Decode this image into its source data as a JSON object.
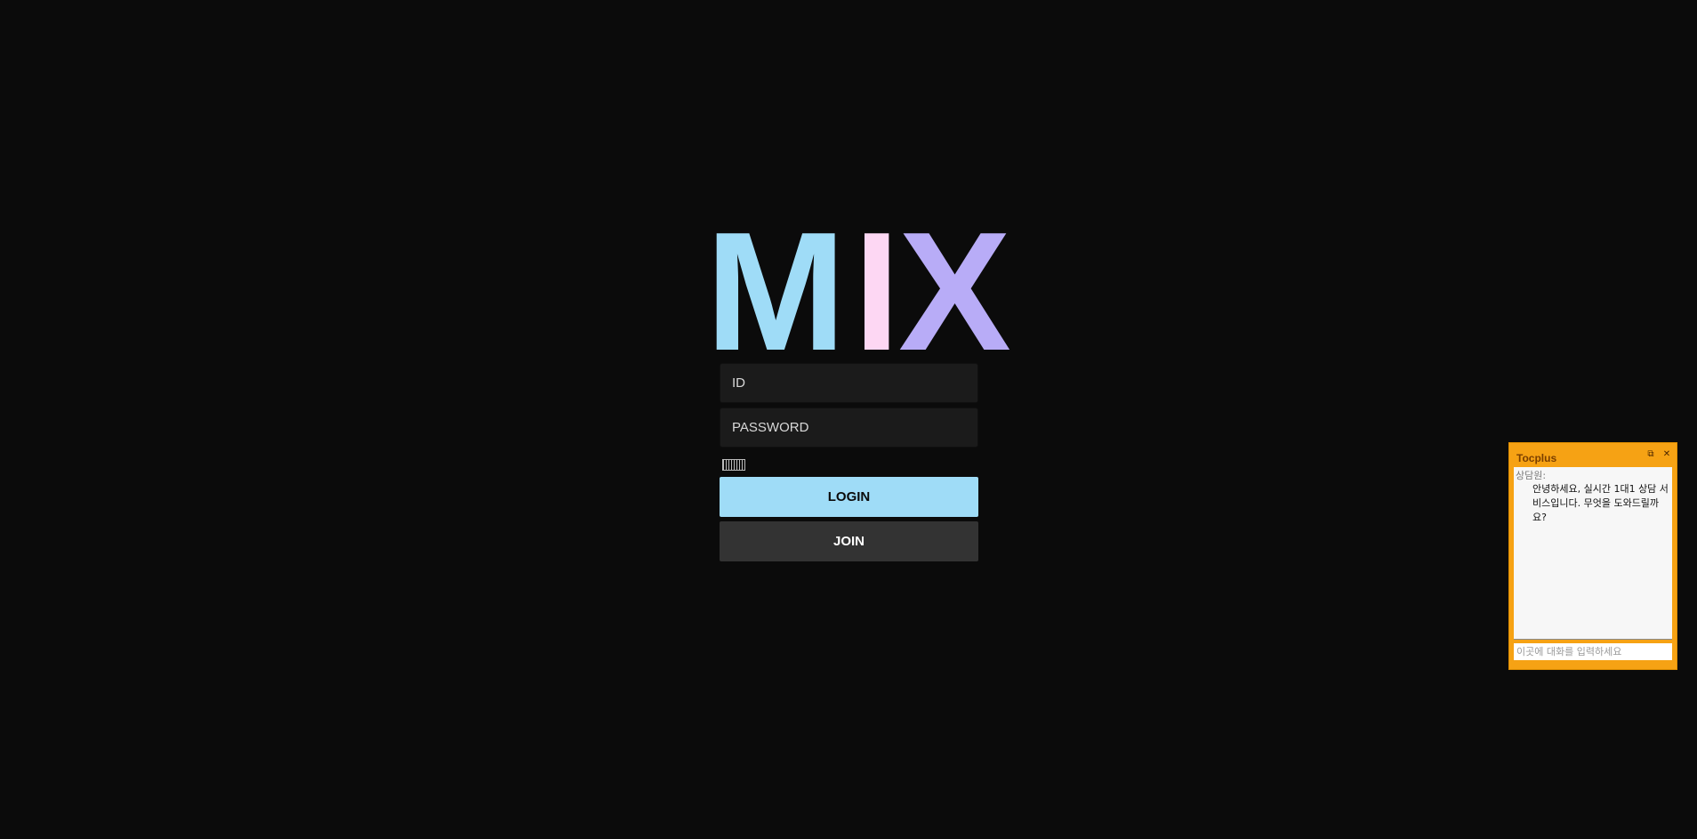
{
  "logo": {
    "letters": [
      "M",
      "I",
      "X"
    ],
    "colors": [
      "#9fdcf7",
      "#fdd7f3",
      "#b8acf7"
    ]
  },
  "login": {
    "id_placeholder": "ID",
    "password_placeholder": "PASSWORD",
    "keyboard_icon": "keyboard-icon",
    "login_label": "LOGIN",
    "join_label": "JOIN",
    "accent": "#9fdcf7"
  },
  "chat": {
    "title": "Tocplus",
    "minimize_icon": "minimize-icon",
    "close_icon": "close-icon",
    "sender": "상담원:",
    "message": "안녕하세요, 실시간 1대1 상담 서비스입니다. 무엇을 도와드릴까요?",
    "input_placeholder": "이곳에 대화를 입력하세요",
    "color": "#f6a214"
  }
}
